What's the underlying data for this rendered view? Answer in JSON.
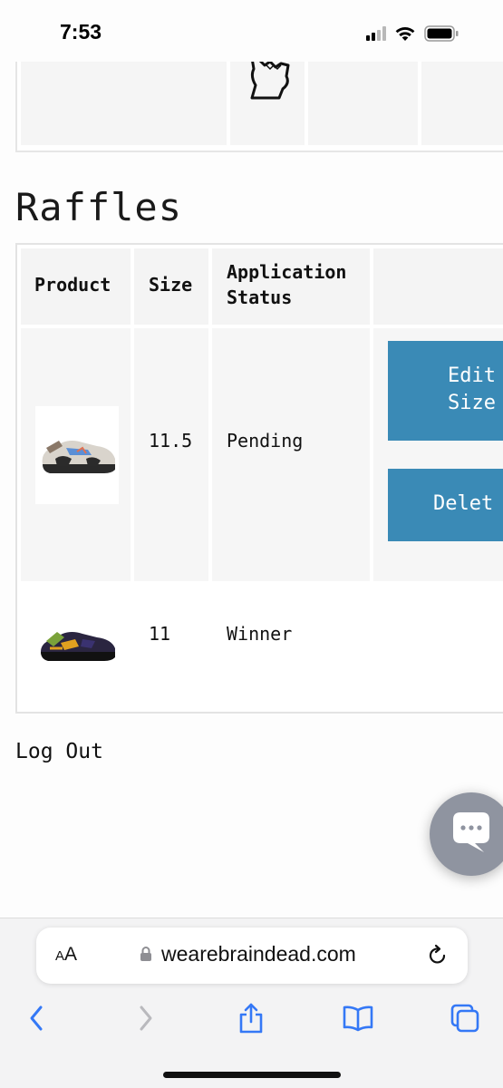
{
  "status_bar": {
    "time": "7:53"
  },
  "raffles": {
    "title": "Raffles",
    "headers": {
      "product": "Product",
      "size": "Size",
      "status_line1": "Application",
      "status_line2": "Status"
    },
    "rows": [
      {
        "product_icon": "sneaker-image",
        "size": "11.5",
        "status": "Pending"
      },
      {
        "product_icon": "sneaker-image",
        "size": "11",
        "status": "Winner"
      }
    ],
    "actions": {
      "edit_line1": "Edit",
      "edit_line2": "Size",
      "delete": "Delet"
    }
  },
  "logout_label": "Log Out",
  "safari": {
    "aa_small": "A",
    "aa_large": "A",
    "url": "wearebraindead.com"
  },
  "colors": {
    "accent_button": "#3a8ab6",
    "safari_blue": "#3478f6"
  }
}
